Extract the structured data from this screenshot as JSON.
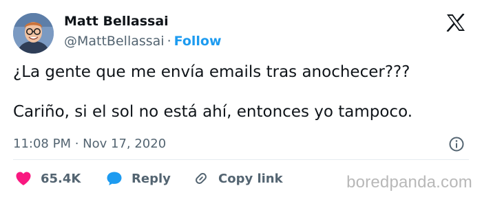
{
  "author": {
    "name": "Matt Bellassai",
    "handle": "@MattBellassai",
    "separator": "·",
    "follow_label": "Follow"
  },
  "tweet": {
    "line1": "¿La gente que me envía emails tras anochecer???",
    "line2": "Cariño, si el sol no está ahí, entonces yo tampoco.",
    "timestamp": "11:08 PM · Nov 17, 2020"
  },
  "actions": {
    "likes": "65.4K",
    "reply_label": "Reply",
    "copy_label": "Copy link"
  },
  "icons": {
    "logo": "x-logo-icon",
    "info": "info-icon",
    "like": "heart-icon",
    "reply": "speech-bubble-icon",
    "copy": "link-icon"
  },
  "watermark": "boredpanda.com",
  "colors": {
    "text": "#0f1419",
    "secondary": "#536471",
    "accent": "#1d9bf0",
    "like": "#f91880"
  }
}
